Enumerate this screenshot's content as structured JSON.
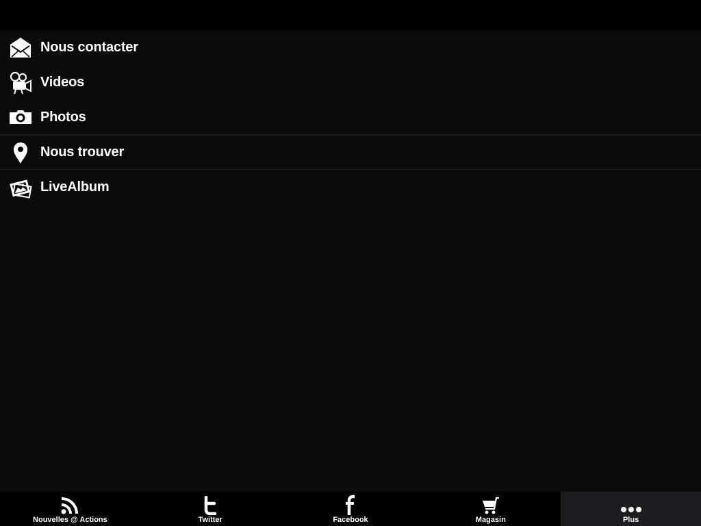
{
  "menu": {
    "items": [
      {
        "label": "Nous contacter",
        "icon": "envelope-icon"
      },
      {
        "label": "Videos",
        "icon": "video-camera-icon"
      },
      {
        "label": "Photos",
        "icon": "camera-icon"
      },
      {
        "label": "Nous trouver",
        "icon": "map-pin-icon"
      },
      {
        "label": "LiveAlbum",
        "icon": "photo-album-icon"
      }
    ]
  },
  "tabbar": {
    "tabs": [
      {
        "label": "Nouvelles @ Actions",
        "icon": "rss-icon"
      },
      {
        "label": "Twitter",
        "icon": "twitter-icon"
      },
      {
        "label": "Facebook",
        "icon": "facebook-icon"
      },
      {
        "label": "Magasin",
        "icon": "cart-icon"
      },
      {
        "label": "Plus",
        "icon": "more-dots-icon",
        "active": true
      }
    ]
  },
  "colors": {
    "background": "#0b0a0d",
    "bars": "#000000",
    "active_tab": "#1d1c20",
    "text": "#ffffff"
  }
}
